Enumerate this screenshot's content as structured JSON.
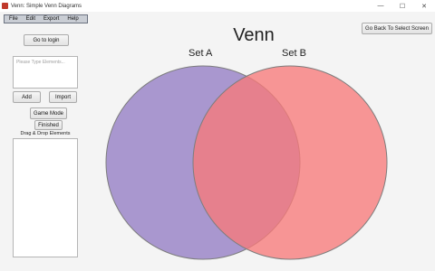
{
  "window": {
    "title": "Venn: Simple Venn Diagrams",
    "controls": {
      "minimize": "—",
      "maximize": "☐",
      "close": "✕"
    }
  },
  "menu": [
    "File",
    "Edit",
    "Export",
    "Help"
  ],
  "left_panel": {
    "login_button": "Go to login",
    "elements_placeholder": "Please Type Elements...",
    "add_button": "Add",
    "import_button": "Import",
    "game_mode_button": "Game Mode",
    "finished_button": "Finished",
    "drag_drop_label": "Drag & Drop Elements"
  },
  "main": {
    "title": "Venn",
    "back_button": "Go Back To Select Screen",
    "set_a": {
      "label": "Set A",
      "color": "#9b86c8"
    },
    "set_b": {
      "label": "Set B",
      "color": "#f77a7a"
    }
  }
}
